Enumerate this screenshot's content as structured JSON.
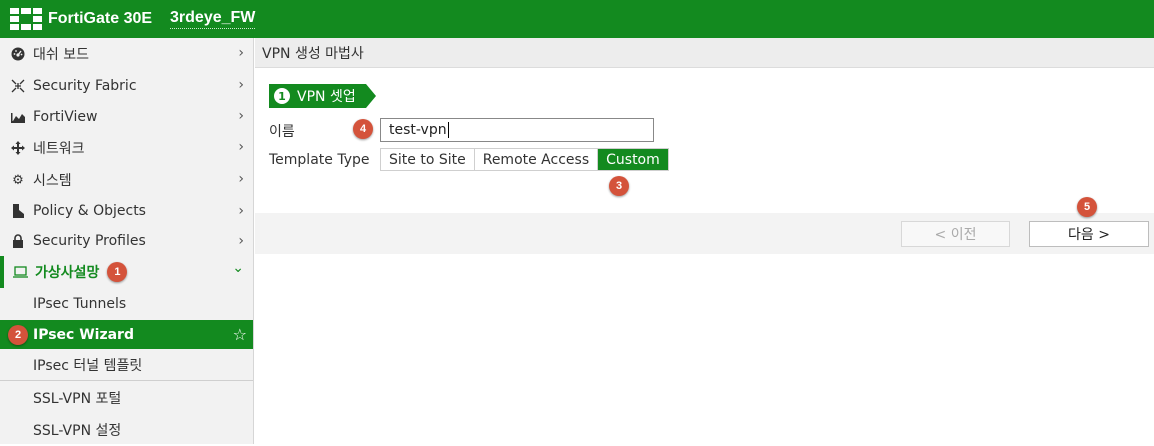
{
  "header": {
    "product": "FortiGate 30E",
    "hostname": "3rdeye_FW",
    "logo_icon": "fortinet-logo-icon",
    "bg_color": "#138a1f"
  },
  "sidebar": {
    "items": [
      {
        "label": "대쉬 보드",
        "icon": "dashboard-icon"
      },
      {
        "label": "Security Fabric",
        "icon": "security-fabric-icon"
      },
      {
        "label": "FortiView",
        "icon": "fortiview-icon"
      },
      {
        "label": "네트워크",
        "icon": "network-icon"
      },
      {
        "label": "시스템",
        "icon": "gear-icon"
      },
      {
        "label": "Policy & Objects",
        "icon": "policy-icon"
      },
      {
        "label": "Security Profiles",
        "icon": "lock-icon"
      },
      {
        "label": "가상사설망",
        "icon": "vpn-icon",
        "expanded": true
      }
    ],
    "sub_items": [
      {
        "label": "IPsec Tunnels"
      },
      {
        "label": "IPsec Wizard",
        "active": true
      },
      {
        "label": "IPsec 터널 템플릿"
      },
      {
        "label": "SSL-VPN 포털"
      },
      {
        "label": "SSL-VPN 설정"
      }
    ]
  },
  "main": {
    "title": "VPN 생성 마법사",
    "step": {
      "number": "1",
      "label": "VPN 셋업"
    },
    "name_label": "이름",
    "name_value": "test-vpn",
    "template_label": "Template Type",
    "template_options": [
      "Site to Site",
      "Remote Access",
      "Custom"
    ],
    "template_selected": "Custom",
    "prev_button": "< 이전",
    "next_button": "다음 >"
  },
  "annotations": [
    "1",
    "2",
    "3",
    "4",
    "5"
  ]
}
